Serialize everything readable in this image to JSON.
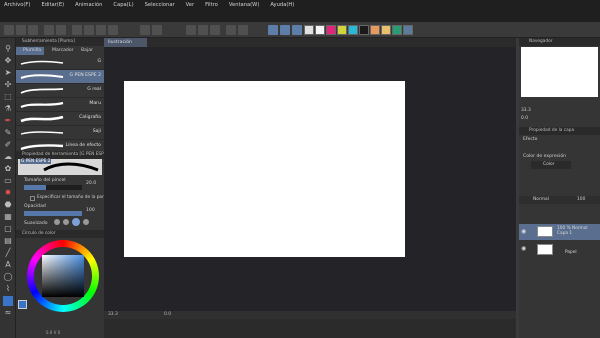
{
  "menu": [
    "Archivo(F)",
    "Editar(E)",
    "Animación",
    "Capa(L)",
    "Seleccionar",
    "Ver",
    "Filtro",
    "Ventana(W)",
    "Ayuda(H)"
  ],
  "command_bar": {
    "swatches": [
      "#e0e0e0",
      "#f4f4f4",
      "#e3257d",
      "#d2d43d",
      "#2ab8d8",
      "#1a1a1a",
      "#e89a5d",
      "#e8c16d",
      "#2a9c73",
      "#5d7b9c"
    ]
  },
  "left_panel": {
    "sub_tool_title": "Subherramienta [Pluma]",
    "tabs": [
      "Plumilla",
      "Marcador",
      "Bajar"
    ],
    "brushes": [
      {
        "label": "G",
        "selected": false
      },
      {
        "label": "G PEN ESPE 2",
        "selected": true
      },
      {
        "label": "G real",
        "selected": false
      },
      {
        "label": "Maru",
        "selected": false
      },
      {
        "label": "Caligrafía",
        "selected": false
      },
      {
        "label": "Saji",
        "selected": false
      },
      {
        "label": "Línea de efecto",
        "selected": false
      },
      {
        "label": "Texturizado",
        "selected": false
      }
    ],
    "tool_props_title": "Propiedad de herramienta [G PEN ESPE 2]",
    "brush_name": "G PEN ESPE 2",
    "size_label": "Tamaño del pincel",
    "size_value": "20.0",
    "specify_screen_label": "Especificar el tamaño de la pantalla",
    "opacity_label": "Opacidad",
    "opacity_value": "100",
    "smoothing_label": "Suavizado",
    "color_panel_title": "Círculo de color",
    "hsv_readout": "S 0 V 0"
  },
  "canvas": {
    "tab_label": "Ilustración",
    "zoom": "33.3",
    "angle": "0.0"
  },
  "right_panel": {
    "navigator_title": "Navegador",
    "nav_zoom": "33.3",
    "nav_angle": "0.0",
    "layer_props_title": "Propiedad de la capa",
    "effect_label": "Efecto",
    "expression_color_label": "Color de expresión",
    "expression_color_value": "Color",
    "blend_mode": "Normal",
    "opacity": "100",
    "layers": [
      {
        "name": "100 % Normal\nCapa 1",
        "selected": true
      },
      {
        "name": "Papel",
        "selected": false
      }
    ]
  }
}
